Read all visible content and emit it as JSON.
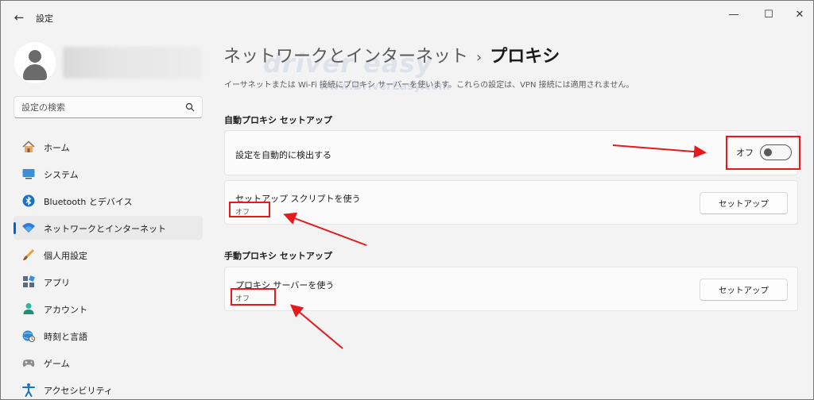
{
  "window": {
    "title": "設定",
    "back_icon": "back-arrow-icon",
    "controls": {
      "minimize": "—",
      "maximize": "☐",
      "close": "✕"
    }
  },
  "sidebar": {
    "search": {
      "placeholder": "設定の検索",
      "value": ""
    },
    "items": [
      {
        "label": "ホーム",
        "icon": "home-icon",
        "selected": false
      },
      {
        "label": "システム",
        "icon": "system-icon",
        "selected": false
      },
      {
        "label": "Bluetooth とデバイス",
        "icon": "bluetooth-icon",
        "selected": false
      },
      {
        "label": "ネットワークとインターネット",
        "icon": "network-icon",
        "selected": true
      },
      {
        "label": "個人用設定",
        "icon": "brush-icon",
        "selected": false
      },
      {
        "label": "アプリ",
        "icon": "apps-icon",
        "selected": false
      },
      {
        "label": "アカウント",
        "icon": "account-icon",
        "selected": false
      },
      {
        "label": "時刻と言語",
        "icon": "time-language-icon",
        "selected": false
      },
      {
        "label": "ゲーム",
        "icon": "gaming-icon",
        "selected": false
      },
      {
        "label": "アクセシビリティ",
        "icon": "accessibility-icon",
        "selected": false
      }
    ]
  },
  "main": {
    "breadcrumb": {
      "parent": "ネットワークとインターネット",
      "separator": "›",
      "current": "プロキシ"
    },
    "watermark": "driver easy",
    "watermark_url": "www.DriverEasy.com",
    "description": "イーサネットまたは Wi-Fi 接続にプロキシ サーバーを使います。これらの設定は、VPN 接続には適用されません。",
    "auto_section": {
      "title": "自動プロキシ セットアップ",
      "detect": {
        "label": "設定を自動的に検出する",
        "state_label": "オフ",
        "enabled": false
      },
      "script": {
        "label": "セットアップ スクリプトを使う",
        "status": "オフ",
        "button": "セットアップ"
      }
    },
    "manual_section": {
      "title": "手動プロキシ セットアップ",
      "proxy": {
        "label": "プロキシ サーバーを使う",
        "status": "オフ",
        "button": "セットアップ"
      }
    }
  },
  "colors": {
    "accent": "#0067c0",
    "annotation": "#e8191c",
    "background": "#f3f3f3",
    "card": "#fbfbfb"
  }
}
